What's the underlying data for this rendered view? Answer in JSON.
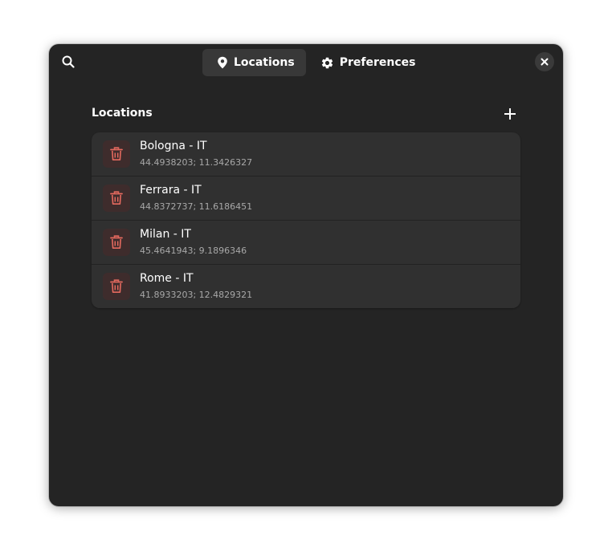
{
  "header": {
    "search_icon": "search-icon",
    "tabs": [
      {
        "label": "Locations",
        "icon": "map-pin-icon",
        "active": true
      },
      {
        "label": "Preferences",
        "icon": "gear-icon",
        "active": false
      }
    ],
    "close_icon": "close-icon"
  },
  "locations": {
    "title": "Locations",
    "add_icon": "plus-icon",
    "items": [
      {
        "name": "Bologna - IT",
        "coords": "44.4938203; 11.3426327"
      },
      {
        "name": "Ferrara - IT",
        "coords": "44.8372737; 11.6186451"
      },
      {
        "name": "Milan - IT",
        "coords": "45.4641943; 9.1896346"
      },
      {
        "name": "Rome - IT",
        "coords": "41.8933203; 12.4829321"
      }
    ]
  },
  "colors": {
    "window_bg": "#242424",
    "list_bg": "#303030",
    "destructive": "#e66a5f",
    "trash_button_bg": "#3e2c2c"
  }
}
